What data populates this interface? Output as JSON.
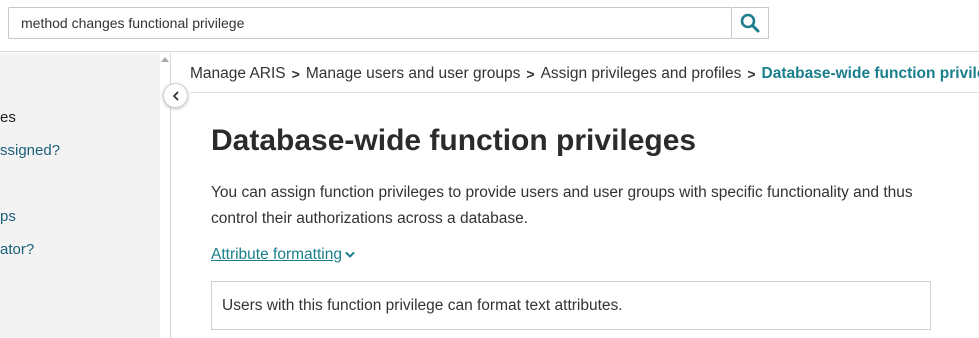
{
  "search": {
    "value": "method changes functional privilege",
    "placeholder": ""
  },
  "sidebar": {
    "items": [
      {
        "label": "es",
        "state": "current"
      },
      {
        "label": "ssigned?",
        "state": "link"
      },
      {
        "label": "ps",
        "state": "link"
      },
      {
        "label": "ator?",
        "state": "link"
      }
    ]
  },
  "breadcrumb": {
    "items": [
      "Manage ARIS",
      "Manage users and user groups",
      "Assign privileges and profiles"
    ],
    "current": "Database-wide function privile",
    "separator": ">"
  },
  "main": {
    "title": "Database-wide function privileges",
    "intro": "You can assign function privileges to provide users and user groups with specific functionality and thus control their authorizations across a database.",
    "expander_label": "Attribute formatting",
    "info_text": "Users with this function privilege can format text attributes."
  },
  "colors": {
    "accent": "#1a7f8c",
    "link": "#1a5f7a",
    "sidebar_bg": "#f3f3f3",
    "border": "#d0d0d0"
  },
  "icons": {
    "search": "search-icon",
    "collapse": "chevron-left-icon",
    "expander": "chevron-down-icon"
  }
}
